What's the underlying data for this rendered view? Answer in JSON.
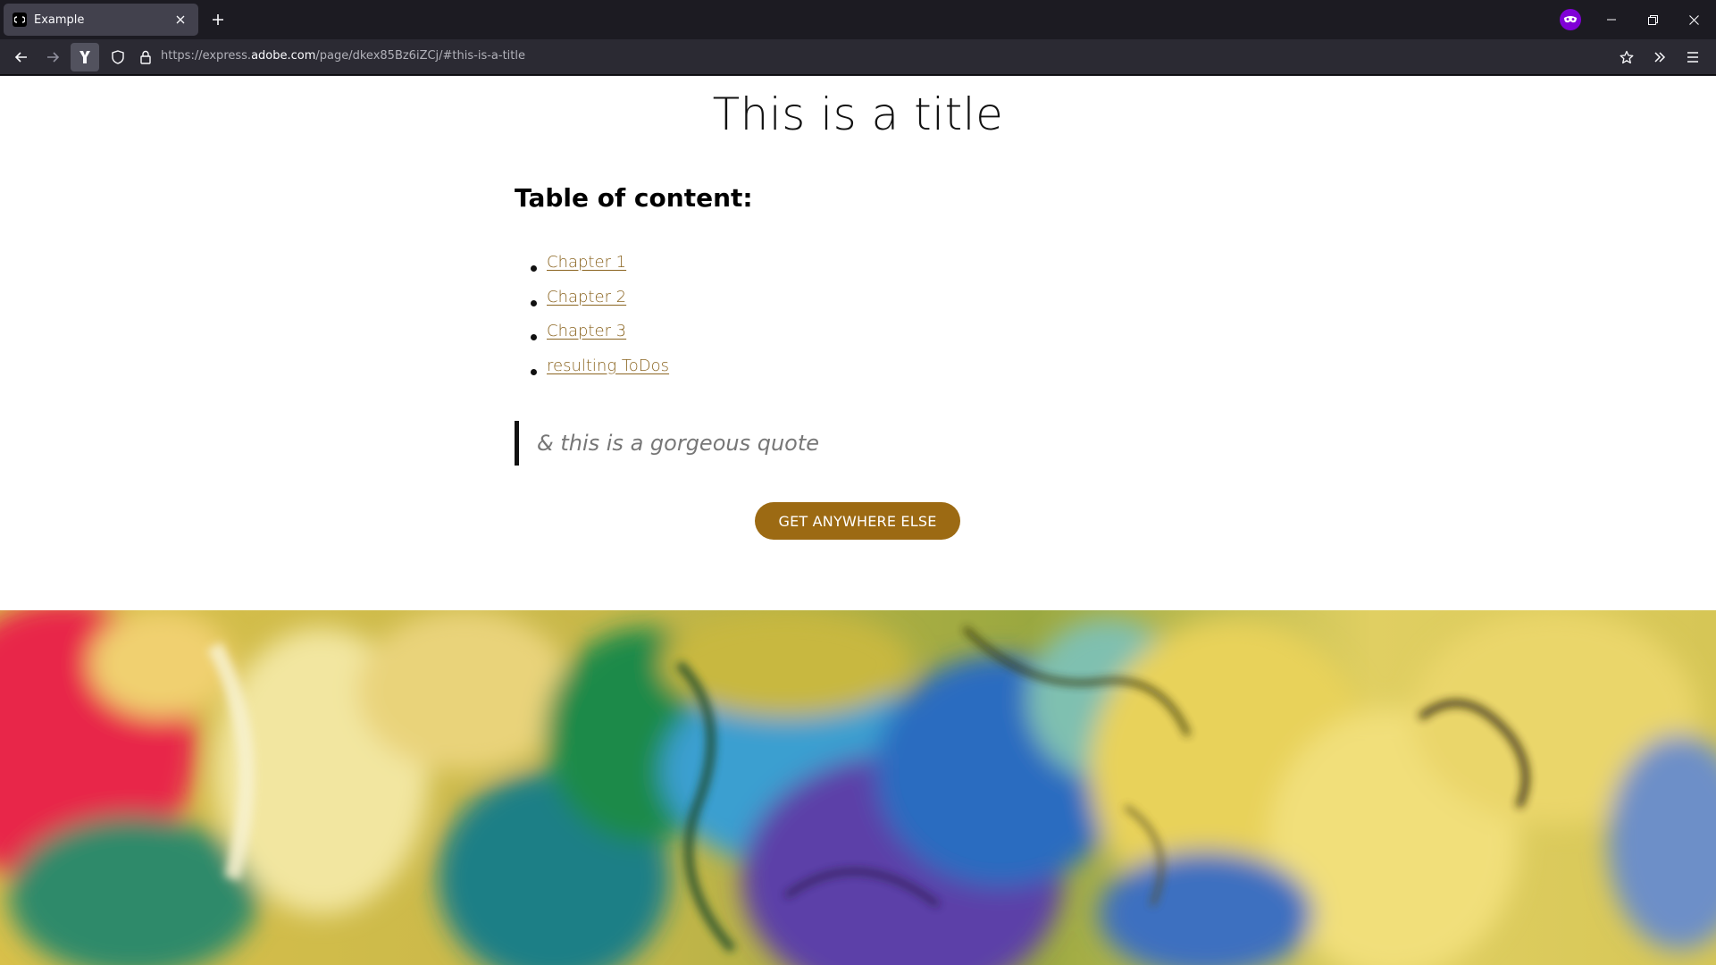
{
  "browser": {
    "tab": {
      "title": "Example"
    },
    "url": {
      "prefix": "https://express.",
      "domain": "adobe.com",
      "path": "/page/dkex85Bz6iZCj/#this-is-a-title"
    }
  },
  "page": {
    "title": "This is a title",
    "toc_heading": "Table of content:",
    "toc_items": [
      {
        "label": "Chapter 1"
      },
      {
        "label": "Chapter 2"
      },
      {
        "label": "Chapter 3"
      },
      {
        "label": "resulting ToDos"
      }
    ],
    "quote": "& this is a gorgeous quote",
    "cta_label": "GET ANYWHERE ELSE"
  },
  "colors": {
    "accent": "#9c6a13",
    "link": "#8b6521",
    "private_badge": "#8000d7"
  },
  "icons": {
    "hero_image": "abstract fluid paint image"
  }
}
